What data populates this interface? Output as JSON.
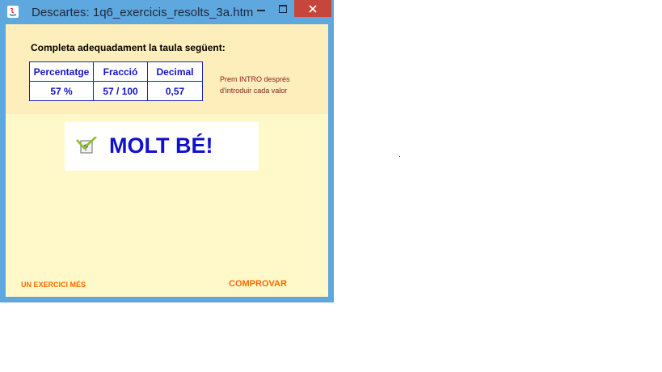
{
  "window": {
    "title": "Descartes: 1q6_exercicis_resolts_3a.htm"
  },
  "exercise": {
    "instruction": "Completa adequadament la taula següent:",
    "table": {
      "headers": [
        "Percentatge",
        "Fracció",
        "Decimal"
      ],
      "values": [
        "57  %",
        "57 / 100",
        "0,57"
      ]
    },
    "hint_lines": [
      "Prem INTRO després",
      "d'introduir cada valor"
    ]
  },
  "feedback": {
    "text": "MOLT BÉ!",
    "icon": "checkmark-icon"
  },
  "buttons": {
    "next": "UN EXERCICI MÉS",
    "check": "COMPROVAR"
  },
  "colors": {
    "titlebar": "#5fa7df",
    "close_button": "#c7463c",
    "panel_background": "#fff8c8",
    "top_panel": "#feeebb",
    "table_text": "#1414c8",
    "feedback_text": "#1010d0",
    "hint_text": "#8b1a1a",
    "action_text": "#ff6a00"
  }
}
